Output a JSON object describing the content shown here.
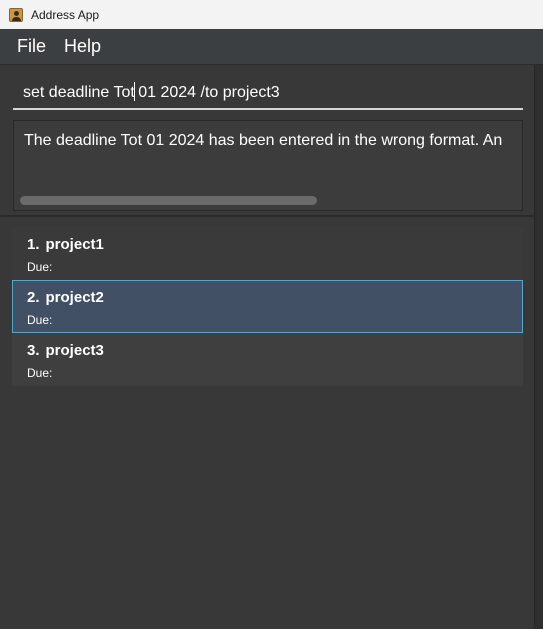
{
  "window": {
    "title": "Address App"
  },
  "menu": {
    "items": [
      "File",
      "Help"
    ]
  },
  "command": {
    "value_before_caret": "set deadline Tot",
    "value_after_caret": " 01 2024 /to project3"
  },
  "result": {
    "message": "The deadline Tot 01 2024 has been entered in the wrong format. An"
  },
  "projects": [
    {
      "index": "1.",
      "name": "project1",
      "due_label": "Due:"
    },
    {
      "index": "2.",
      "name": "project2",
      "due_label": "Due:"
    },
    {
      "index": "3.",
      "name": "project3",
      "due_label": "Due:"
    }
  ],
  "selected_index": 1,
  "colors": {
    "accent": "#5aa4c8",
    "selected_bg": "#425065",
    "background": "#383838"
  }
}
